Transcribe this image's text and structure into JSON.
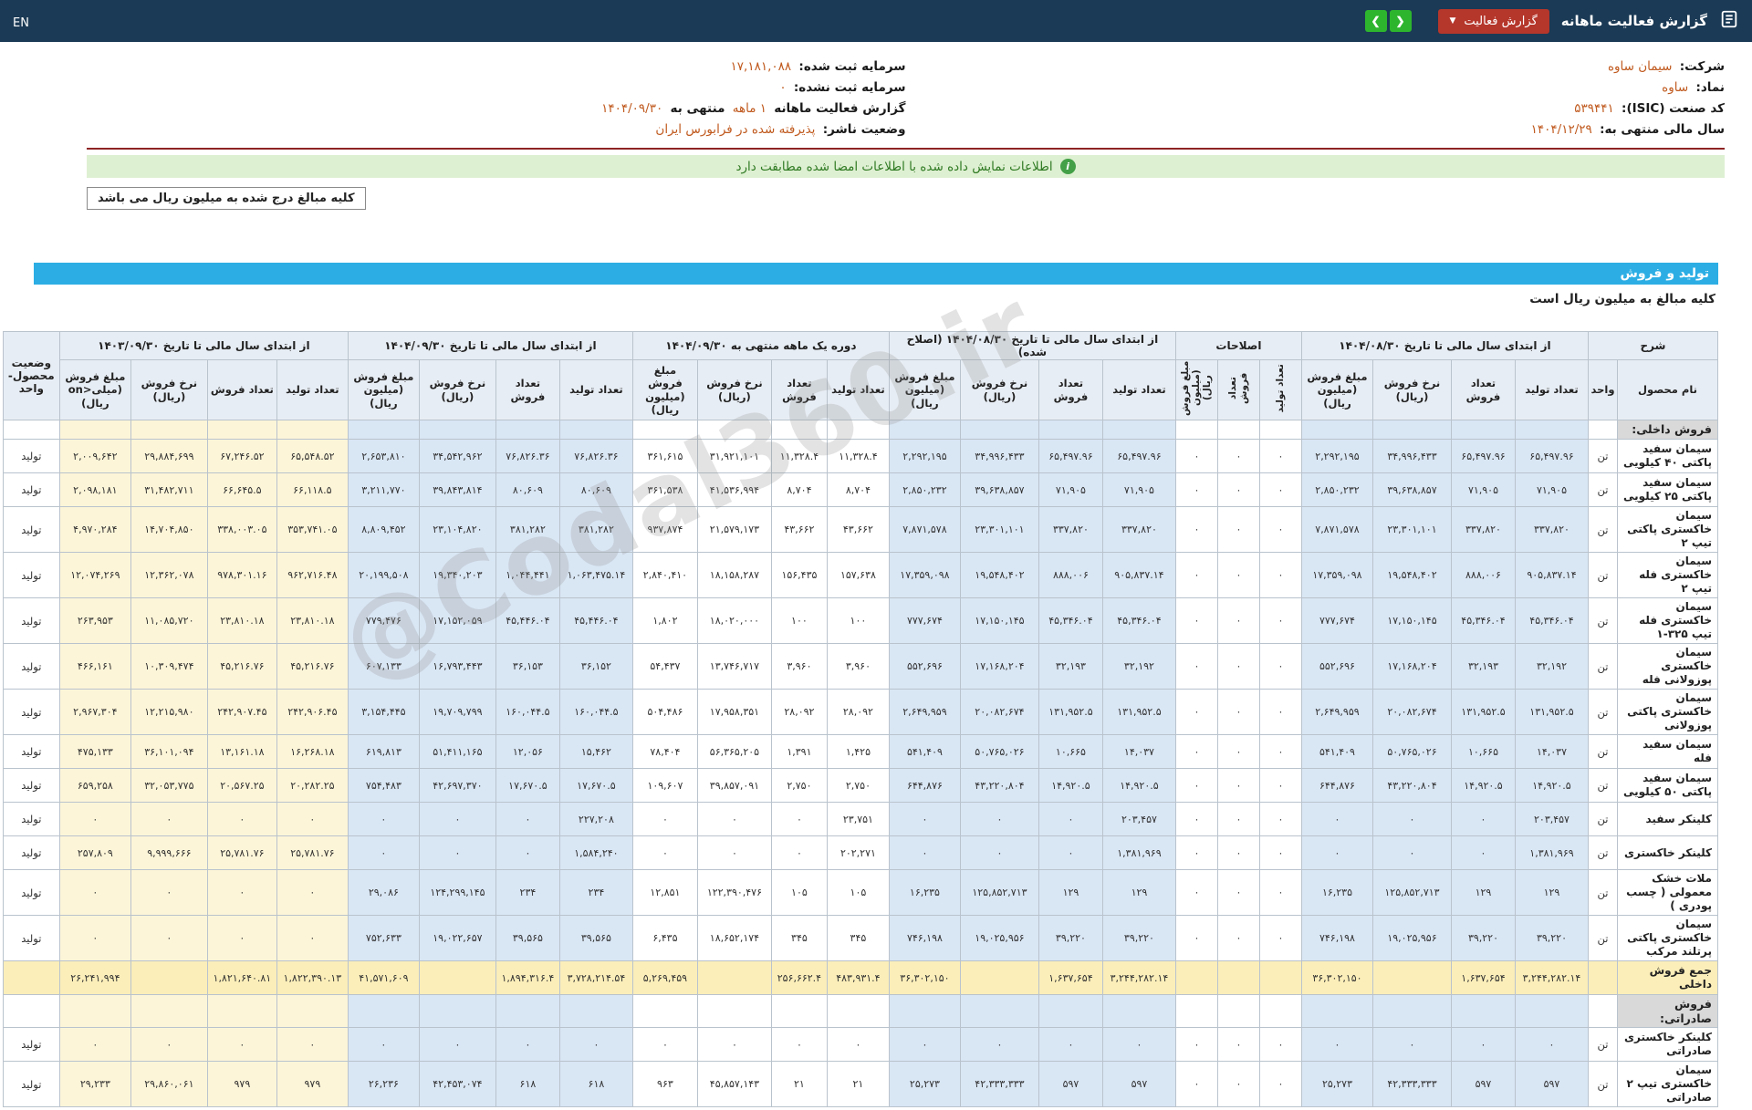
{
  "navbar": {
    "title": "گزارش فعالیت ماهانه",
    "report_button": "گزارش فعالیت",
    "en_label": "EN"
  },
  "info": {
    "right": [
      {
        "parts": [
          [
            "شرکت:",
            "l"
          ],
          [
            "سیمان ساوه",
            "v"
          ]
        ]
      },
      {
        "parts": [
          [
            "نماد:",
            "l"
          ],
          [
            "ساوه",
            "v"
          ]
        ]
      },
      {
        "parts": [
          [
            "کد صنعت (ISIC):",
            "l"
          ],
          [
            "۵۳۹۴۴۱",
            "v"
          ]
        ]
      },
      {
        "parts": [
          [
            "سال مالی منتهی به:",
            "l"
          ],
          [
            "۱۴۰۴/۱۲/۲۹",
            "v"
          ]
        ]
      }
    ],
    "left": [
      {
        "parts": [
          [
            "سرمایه ثبت شده:",
            "l"
          ],
          [
            "۱۷,۱۸۱,۰۸۸",
            "v"
          ]
        ]
      },
      {
        "parts": [
          [
            "سرمایه ثبت نشده:",
            "l"
          ],
          [
            "۰",
            "v"
          ]
        ]
      },
      {
        "parts": [
          [
            "گزارش فعالیت ماهانه",
            "l"
          ],
          [
            "۱ ماهه",
            "v"
          ],
          [
            "منتهی به",
            "l"
          ],
          [
            "۱۴۰۴/۰۹/۳۰",
            "v"
          ]
        ]
      },
      {
        "parts": [
          [
            "وضعیت ناشر:",
            "l"
          ],
          [
            "پذیرفته شده در فرابورس ایران",
            "v"
          ]
        ]
      }
    ]
  },
  "banner": {
    "text": "اطلاعات نمایش داده شده با اطلاعات امضا شده مطابقت دارد"
  },
  "note": {
    "text": "کلیه مبالغ درج شده به میلیون ریال می باشد"
  },
  "watermark": {
    "text": "@Codal360.ir"
  },
  "table": {
    "title": "تولید و فروش",
    "subtitle": "کلیه مبالغ به میلیون ریال است",
    "header": {
      "desc": "شرح",
      "name": "نام محصول",
      "unit": "واحد",
      "status": "وضعیت محصول- واحد",
      "groups": [
        {
          "label": "از ابتدای سال مالی تا تاریخ ۱۴۰۴/۰۸/۳۰",
          "cols": [
            "تعداد تولید",
            "تعداد فروش",
            "نرخ فروش (ریال)",
            "مبلغ فروش (میلیون ریال)"
          ]
        },
        {
          "label": "اصلاحات",
          "vertical": true,
          "cols": [
            "تعداد تولید",
            "تعداد فروش",
            "مبلغ فروش (میلیون ریال)"
          ]
        },
        {
          "label": "از ابتدای سال مالی تا تاریخ ۱۴۰۴/۰۸/۳۰ (اصلاح شده)",
          "cols": [
            "تعداد تولید",
            "تعداد فروش",
            "نرخ فروش (ریال)",
            "مبلغ فروش (میلیون ریال)"
          ]
        },
        {
          "label": "دوره یک ماهه منتهی به ۱۴۰۴/۰۹/۳۰",
          "cols": [
            "تعداد تولید",
            "تعداد فروش",
            "نرخ فروش (ریال)",
            "مبلغ فروش (میلیون ریال)"
          ]
        },
        {
          "label": "از ابتدای سال مالی تا تاریخ ۱۴۰۴/۰۹/۳۰",
          "cols": [
            "تعداد تولید",
            "تعداد فروش",
            "نرخ فروش (ریال)",
            "مبلغ فروش (میلیون ریال)"
          ]
        },
        {
          "label": "از ابتدای سال مالی تا تاریخ ۱۴۰۳/۰۹/۳۰",
          "cols": [
            "تعداد تولید",
            "تعداد فروش",
            "نرخ فروش (ریال)",
            "مبلغ فروش (میلی<on ریال)"
          ]
        }
      ]
    },
    "rows": [
      {
        "type": "section",
        "name": "فروش داخلی:"
      },
      {
        "type": "product",
        "name": "سیمان سفید پاکتی ۴۰ کیلویی",
        "unit": "تن",
        "status": "تولید",
        "cells": [
          "۶۵,۴۹۷.۹۶",
          "۶۵,۴۹۷.۹۶",
          "۳۴,۹۹۶,۴۳۳",
          "۲,۲۹۲,۱۹۵",
          "۰",
          "۰",
          "۰",
          "۶۵,۴۹۷.۹۶",
          "۶۵,۴۹۷.۹۶",
          "۳۴,۹۹۶,۴۳۳",
          "۲,۲۹۲,۱۹۵",
          "۱۱,۳۲۸.۴",
          "۱۱,۳۲۸.۴",
          "۳۱,۹۲۱,۱۰۱",
          "۳۶۱,۶۱۵",
          "۷۶,۸۲۶.۳۶",
          "۷۶,۸۲۶.۳۶",
          "۳۴,۵۴۲,۹۶۲",
          "۲,۶۵۳,۸۱۰",
          "۶۵,۵۴۸.۵۲",
          "۶۷,۲۴۶.۵۲",
          "۲۹,۸۸۴,۶۹۹",
          "۲,۰۰۹,۶۴۲"
        ]
      },
      {
        "type": "product",
        "name": "سیمان سفید پاکتی ۲۵ کیلویی",
        "unit": "تن",
        "status": "تولید",
        "cells": [
          "۷۱,۹۰۵",
          "۷۱,۹۰۵",
          "۳۹,۶۳۸,۸۵۷",
          "۲,۸۵۰,۲۳۲",
          "۰",
          "۰",
          "۰",
          "۷۱,۹۰۵",
          "۷۱,۹۰۵",
          "۳۹,۶۳۸,۸۵۷",
          "۲,۸۵۰,۲۳۲",
          "۸,۷۰۴",
          "۸,۷۰۴",
          "۴۱,۵۳۶,۹۹۴",
          "۳۶۱,۵۳۸",
          "۸۰,۶۰۹",
          "۸۰,۶۰۹",
          "۳۹,۸۴۳,۸۱۴",
          "۳,۲۱۱,۷۷۰",
          "۶۶,۱۱۸.۵",
          "۶۶,۶۴۵.۵",
          "۳۱,۴۸۲,۷۱۱",
          "۲,۰۹۸,۱۸۱"
        ]
      },
      {
        "type": "product",
        "name": "سیمان خاکستری پاکتی تیپ ۲",
        "unit": "تن",
        "status": "تولید",
        "cells": [
          "۳۳۷,۸۲۰",
          "۳۳۷,۸۲۰",
          "۲۳,۳۰۱,۱۰۱",
          "۷,۸۷۱,۵۷۸",
          "۰",
          "۰",
          "۰",
          "۳۳۷,۸۲۰",
          "۳۳۷,۸۲۰",
          "۲۳,۳۰۱,۱۰۱",
          "۷,۸۷۱,۵۷۸",
          "۴۳,۶۶۲",
          "۴۳,۶۶۲",
          "۲۱,۵۷۹,۱۷۳",
          "۹۳۷,۸۷۴",
          "۳۸۱,۲۸۲",
          "۳۸۱,۲۸۲",
          "۲۳,۱۰۴,۸۲۰",
          "۸,۸۰۹,۴۵۲",
          "۳۵۳,۷۴۱.۰۵",
          "۳۳۸,۰۰۳.۰۵",
          "۱۴,۷۰۴,۸۵۰",
          "۴,۹۷۰,۲۸۴"
        ]
      },
      {
        "type": "product",
        "name": "سیمان خاکستری فله تیپ ۲",
        "unit": "تن",
        "status": "تولید",
        "cells": [
          "۹۰۵,۸۳۷.۱۴",
          "۸۸۸,۰۰۶",
          "۱۹,۵۴۸,۴۰۲",
          "۱۷,۳۵۹,۰۹۸",
          "۰",
          "۰",
          "۰",
          "۹۰۵,۸۳۷.۱۴",
          "۸۸۸,۰۰۶",
          "۱۹,۵۴۸,۴۰۲",
          "۱۷,۳۵۹,۰۹۸",
          "۱۵۷,۶۳۸",
          "۱۵۶,۴۳۵",
          "۱۸,۱۵۸,۲۸۷",
          "۲,۸۴۰,۴۱۰",
          "۱,۰۶۳,۴۷۵.۱۴",
          "۱,۰۴۴,۴۴۱",
          "۱۹,۳۴۰,۲۰۳",
          "۲۰,۱۹۹,۵۰۸",
          "۹۶۲,۷۱۶.۴۸",
          "۹۷۸,۳۰۱.۱۶",
          "۱۲,۳۶۲,۰۷۸",
          "۱۲,۰۷۴,۲۶۹"
        ]
      },
      {
        "type": "product",
        "name": "سیمان خاکستری فله تیپ ۳۲۵-۱",
        "unit": "تن",
        "status": "تولید",
        "cells": [
          "۴۵,۳۴۶.۰۴",
          "۴۵,۳۴۶.۰۴",
          "۱۷,۱۵۰,۱۴۵",
          "۷۷۷,۶۷۴",
          "۰",
          "۰",
          "۰",
          "۴۵,۳۴۶.۰۴",
          "۴۵,۳۴۶.۰۴",
          "۱۷,۱۵۰,۱۴۵",
          "۷۷۷,۶۷۴",
          "۱۰۰",
          "۱۰۰",
          "۱۸,۰۲۰,۰۰۰",
          "۱,۸۰۲",
          "۴۵,۴۴۶.۰۴",
          "۴۵,۴۴۶.۰۴",
          "۱۷,۱۵۲,۰۵۹",
          "۷۷۹,۴۷۶",
          "۲۳,۸۱۰.۱۸",
          "۲۳,۸۱۰.۱۸",
          "۱۱,۰۸۵,۷۲۰",
          "۲۶۳,۹۵۳"
        ]
      },
      {
        "type": "product",
        "name": "سیمان خاکستری پوزولانی فله",
        "unit": "تن",
        "status": "تولید",
        "cells": [
          "۳۲,۱۹۲",
          "۳۲,۱۹۳",
          "۱۷,۱۶۸,۲۰۴",
          "۵۵۲,۶۹۶",
          "۰",
          "۰",
          "۰",
          "۳۲,۱۹۲",
          "۳۲,۱۹۳",
          "۱۷,۱۶۸,۲۰۴",
          "۵۵۲,۶۹۶",
          "۳,۹۶۰",
          "۳,۹۶۰",
          "۱۳,۷۴۶,۷۱۷",
          "۵۴,۴۳۷",
          "۳۶,۱۵۲",
          "۳۶,۱۵۳",
          "۱۶,۷۹۳,۴۴۳",
          "۶۰۷,۱۳۳",
          "۴۵,۲۱۶.۷۶",
          "۴۵,۲۱۶.۷۶",
          "۱۰,۳۰۹,۴۷۴",
          "۴۶۶,۱۶۱"
        ]
      },
      {
        "type": "product",
        "name": "سیمان خاکستری پاکتی پوزولانی",
        "unit": "تن",
        "status": "تولید",
        "cells": [
          "۱۳۱,۹۵۲.۵",
          "۱۳۱,۹۵۲.۵",
          "۲۰,۰۸۲,۶۷۴",
          "۲,۶۴۹,۹۵۹",
          "۰",
          "۰",
          "۰",
          "۱۳۱,۹۵۲.۵",
          "۱۳۱,۹۵۲.۵",
          "۲۰,۰۸۲,۶۷۴",
          "۲,۶۴۹,۹۵۹",
          "۲۸,۰۹۲",
          "۲۸,۰۹۲",
          "۱۷,۹۵۸,۳۵۱",
          "۵۰۴,۴۸۶",
          "۱۶۰,۰۴۴.۵",
          "۱۶۰,۰۴۴.۵",
          "۱۹,۷۰۹,۷۹۹",
          "۳,۱۵۴,۴۴۵",
          "۲۴۲,۹۰۶.۴۵",
          "۲۴۲,۹۰۷.۴۵",
          "۱۲,۲۱۵,۹۸۰",
          "۲,۹۶۷,۳۰۴"
        ]
      },
      {
        "type": "product",
        "name": "سیمان سفید فله",
        "unit": "تن",
        "status": "تولید",
        "cells": [
          "۱۴,۰۳۷",
          "۱۰,۶۶۵",
          "۵۰,۷۶۵,۰۲۶",
          "۵۴۱,۴۰۹",
          "۰",
          "۰",
          "۰",
          "۱۴,۰۳۷",
          "۱۰,۶۶۵",
          "۵۰,۷۶۵,۰۲۶",
          "۵۴۱,۴۰۹",
          "۱,۴۲۵",
          "۱,۳۹۱",
          "۵۶,۳۶۵,۲۰۵",
          "۷۸,۴۰۴",
          "۱۵,۴۶۲",
          "۱۲,۰۵۶",
          "۵۱,۴۱۱,۱۶۵",
          "۶۱۹,۸۱۳",
          "۱۶,۲۶۸.۱۸",
          "۱۳,۱۶۱.۱۸",
          "۳۶,۱۰۱,۰۹۴",
          "۴۷۵,۱۳۳"
        ]
      },
      {
        "type": "product",
        "name": "سیمان سفید پاکتی ۵۰ کیلویی",
        "unit": "تن",
        "status": "تولید",
        "cells": [
          "۱۴,۹۲۰.۵",
          "۱۴,۹۲۰.۵",
          "۴۳,۲۲۰,۸۰۴",
          "۶۴۴,۸۷۶",
          "۰",
          "۰",
          "۰",
          "۱۴,۹۲۰.۵",
          "۱۴,۹۲۰.۵",
          "۴۳,۲۲۰,۸۰۴",
          "۶۴۴,۸۷۶",
          "۲,۷۵۰",
          "۲,۷۵۰",
          "۳۹,۸۵۷,۰۹۱",
          "۱۰۹,۶۰۷",
          "۱۷,۶۷۰.۵",
          "۱۷,۶۷۰.۵",
          "۴۲,۶۹۷,۳۷۰",
          "۷۵۴,۴۸۳",
          "۲۰,۲۸۲.۲۵",
          "۲۰,۵۶۷.۲۵",
          "۳۲,۰۵۳,۷۷۵",
          "۶۵۹,۲۵۸"
        ]
      },
      {
        "type": "product",
        "name": "کلینکر سفید",
        "unit": "تن",
        "status": "تولید",
        "cells": [
          "۲۰۳,۴۵۷",
          "۰",
          "۰",
          "۰",
          "۰",
          "۰",
          "۰",
          "۲۰۳,۴۵۷",
          "۰",
          "۰",
          "۰",
          "۲۳,۷۵۱",
          "۰",
          "۰",
          "۰",
          "۲۲۷,۲۰۸",
          "۰",
          "۰",
          "۰",
          "۰",
          "۰",
          "۰",
          "۰"
        ]
      },
      {
        "type": "product",
        "name": "کلینکر خاکستری",
        "unit": "تن",
        "status": "تولید",
        "cells": [
          "۱,۳۸۱,۹۶۹",
          "۰",
          "۰",
          "۰",
          "۰",
          "۰",
          "۰",
          "۱,۳۸۱,۹۶۹",
          "۰",
          "۰",
          "۰",
          "۲۰۲,۲۷۱",
          "۰",
          "۰",
          "۰",
          "۱,۵۸۴,۲۴۰",
          "۰",
          "۰",
          "۰",
          "۲۵,۷۸۱.۷۶",
          "۲۵,۷۸۱.۷۶",
          "۹,۹۹۹,۶۶۶",
          "۲۵۷,۸۰۹"
        ]
      },
      {
        "type": "product",
        "name": "ملات خشک معمولی ( چسب پودری )",
        "unit": "تن",
        "status": "تولید",
        "cells": [
          "۱۲۹",
          "۱۲۹",
          "۱۲۵,۸۵۲,۷۱۳",
          "۱۶,۲۳۵",
          "۰",
          "۰",
          "۰",
          "۱۲۹",
          "۱۲۹",
          "۱۲۵,۸۵۲,۷۱۳",
          "۱۶,۲۳۵",
          "۱۰۵",
          "۱۰۵",
          "۱۲۲,۳۹۰,۴۷۶",
          "۱۲,۸۵۱",
          "۲۳۴",
          "۲۳۴",
          "۱۲۴,۲۹۹,۱۴۵",
          "۲۹,۰۸۶",
          "۰",
          "۰",
          "۰",
          "۰"
        ]
      },
      {
        "type": "product",
        "name": "سیمان خاکستری پاکتی پرتلند مرکب",
        "unit": "تن",
        "status": "تولید",
        "cells": [
          "۳۹,۲۲۰",
          "۳۹,۲۲۰",
          "۱۹,۰۲۵,۹۵۶",
          "۷۴۶,۱۹۸",
          "۰",
          "۰",
          "۰",
          "۳۹,۲۲۰",
          "۳۹,۲۲۰",
          "۱۹,۰۲۵,۹۵۶",
          "۷۴۶,۱۹۸",
          "۳۴۵",
          "۳۴۵",
          "۱۸,۶۵۲,۱۷۴",
          "۶,۴۳۵",
          "۳۹,۵۶۵",
          "۳۹,۵۶۵",
          "۱۹,۰۲۲,۶۵۷",
          "۷۵۲,۶۳۳",
          "۰",
          "۰",
          "۰",
          "۰"
        ]
      },
      {
        "type": "total",
        "name": "جمع فروش داخلی",
        "unit": "",
        "status": "",
        "cells": [
          "۳,۲۴۴,۲۸۲.۱۴",
          "۱,۶۳۷,۶۵۴",
          "",
          "۳۶,۳۰۲,۱۵۰",
          "",
          "",
          "",
          "۳,۲۴۴,۲۸۲.۱۴",
          "۱,۶۳۷,۶۵۴",
          "",
          "۳۶,۳۰۲,۱۵۰",
          "۴۸۳,۹۳۱.۴",
          "۲۵۶,۶۶۲.۴",
          "",
          "۵,۲۶۹,۴۵۹",
          "۳,۷۲۸,۲۱۴.۵۴",
          "۱,۸۹۴,۳۱۶.۴",
          "",
          "۴۱,۵۷۱,۶۰۹",
          "۱,۸۲۲,۳۹۰.۱۳",
          "۱,۸۲۱,۶۴۰.۸۱",
          "",
          "۲۶,۲۴۱,۹۹۴"
        ]
      },
      {
        "type": "section",
        "name": "فروش صادراتی:"
      },
      {
        "type": "product",
        "name": "کلینکر خاکستری صادراتی",
        "unit": "تن",
        "status": "تولید",
        "cells": [
          "۰",
          "۰",
          "۰",
          "۰",
          "۰",
          "۰",
          "۰",
          "۰",
          "۰",
          "۰",
          "۰",
          "۰",
          "۰",
          "۰",
          "۰",
          "۰",
          "۰",
          "۰",
          "۰",
          "۰",
          "۰",
          "۰",
          "۰"
        ]
      },
      {
        "type": "product",
        "name": "سیمان خاکستری تیپ ۲ صادراتی",
        "unit": "تن",
        "status": "تولید",
        "cells": [
          "۵۹۷",
          "۵۹۷",
          "۴۲,۳۳۳,۳۳۳",
          "۲۵,۲۷۳",
          "۰",
          "۰",
          "۰",
          "۵۹۷",
          "۵۹۷",
          "۴۲,۳۳۳,۳۳۳",
          "۲۵,۲۷۳",
          "۲۱",
          "۲۱",
          "۴۵,۸۵۷,۱۴۳",
          "۹۶۳",
          "۶۱۸",
          "۶۱۸",
          "۴۲,۴۵۳,۰۷۴",
          "۲۶,۲۳۶",
          "۹۷۹",
          "۹۷۹",
          "۲۹,۸۶۰,۰۶۱",
          "۲۹,۲۳۳"
        ]
      }
    ]
  },
  "colors": {
    "navbar-bg": "#1b3a55",
    "red-btn": "#b5362b",
    "green-btn": "#2eb52e",
    "blue-bar": "#2caee4",
    "band-blue": "#d9e6f4",
    "band-yellow": "#fdf5d8",
    "total-yellow": "#fbeeb9",
    "banner-bg": "#def0d2",
    "banner-text": "#2f7a23",
    "value-orange": "#c05a1f",
    "maroon": "#8e2424",
    "border": "#b9c3cd",
    "header-bg": "#e7edf4"
  }
}
